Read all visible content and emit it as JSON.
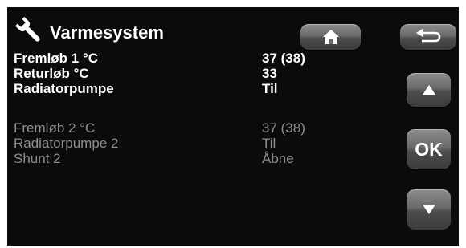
{
  "header": {
    "title": "Varmesystem",
    "title_icon": "wrench-icon",
    "home_icon": "home-icon",
    "back_icon": "back-arrow-icon"
  },
  "circuit1": [
    {
      "label": "Fremløb 1 °C",
      "value": "37  (38)"
    },
    {
      "label": "Returløb °C",
      "value": "33"
    },
    {
      "label": "Radiatorpumpe",
      "value": "Til"
    }
  ],
  "circuit2": [
    {
      "label": "Fremløb 2 °C",
      "value": "37  (38)"
    },
    {
      "label": "Radiatorpumpe 2",
      "value": "Til"
    },
    {
      "label": "Shunt 2",
      "value": "Åbne"
    }
  ],
  "nav": {
    "up_icon": "arrow-up-icon",
    "ok_label": "OK",
    "down_icon": "arrow-down-icon"
  },
  "colors": {
    "background": "#0b0b0b",
    "text_active": "#ffffff",
    "text_inactive": "#8e8e8e",
    "button": "#5a5a5a"
  }
}
